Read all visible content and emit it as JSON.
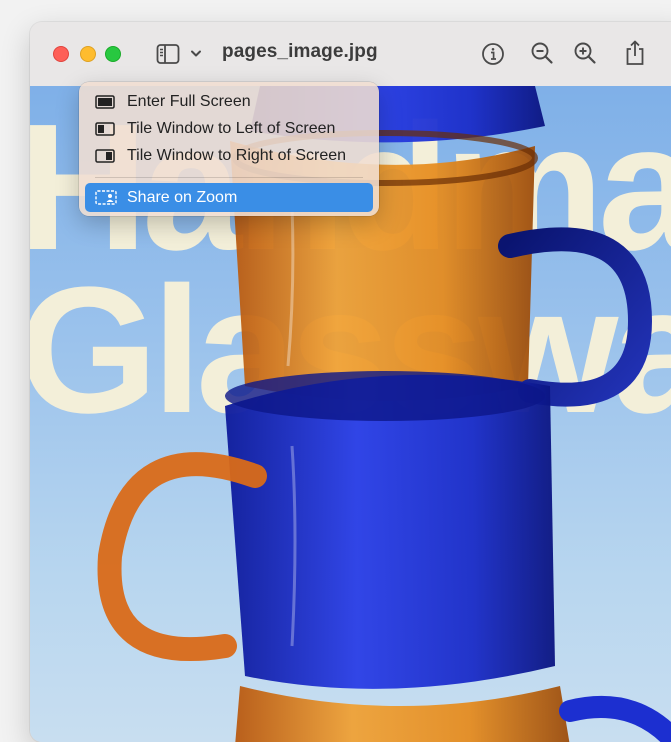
{
  "window": {
    "title": "pages_image.jpg"
  },
  "image": {
    "background_text": [
      "Handma",
      "Glasswa"
    ],
    "colors": {
      "sky": "#9cc3ec",
      "amber_glass": "#e0861f",
      "blue_glass": "#1c2fd0",
      "orange_handle": "#d96a18"
    }
  },
  "menu": {
    "items": [
      {
        "label": "Enter Full Screen",
        "icon": "fullscreen-icon"
      },
      {
        "label": "Tile Window to Left of Screen",
        "icon": "tile-left-icon"
      },
      {
        "label": "Tile Window to Right of Screen",
        "icon": "tile-right-icon"
      },
      {
        "label": "Share on Zoom",
        "icon": "zoom-share-icon",
        "highlighted": true
      }
    ],
    "highlight_color": "#3a8ee6"
  },
  "toolbar": {
    "icons": [
      "sidebar-toggle-icon",
      "chevron-down-icon",
      "info-icon",
      "zoom-out-icon",
      "zoom-in-icon",
      "share-icon"
    ]
  }
}
